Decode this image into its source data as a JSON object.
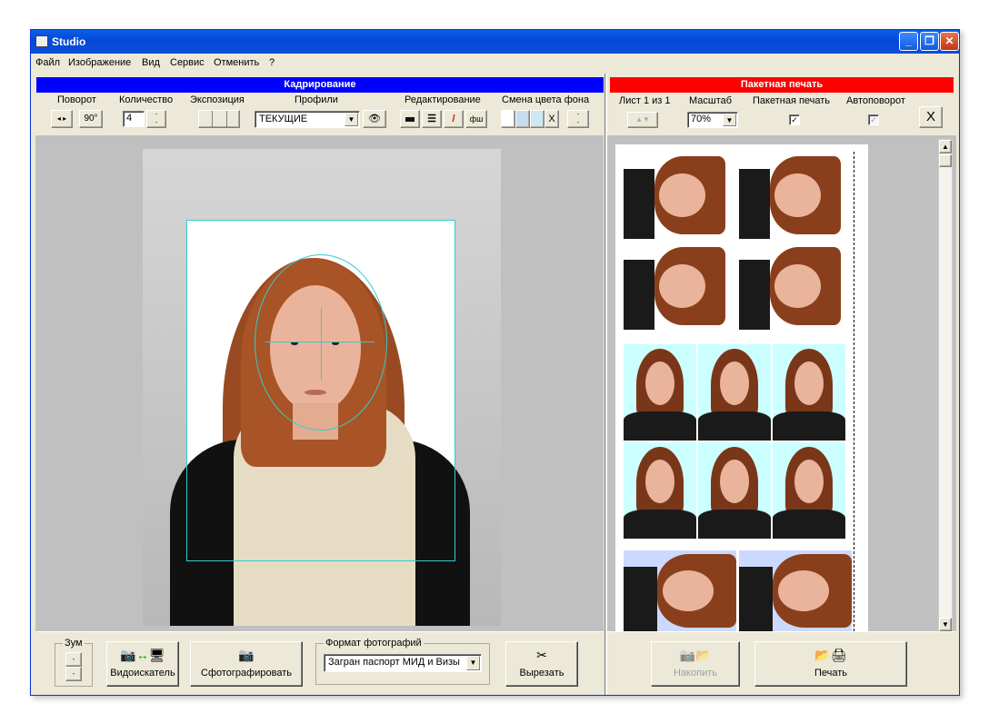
{
  "window": {
    "title": "Studio",
    "min": "_",
    "max": "❐",
    "close": "✕"
  },
  "menu": [
    "Файл",
    "Изображение",
    "Вид",
    "Сервис",
    "Отменить",
    "?"
  ],
  "crop": {
    "header": "Кадрирование",
    "rotate_label": "Поворот",
    "rotate_90": "90°",
    "count_label": "Количество",
    "count_value": "4",
    "exposure_label": "Экспозиция",
    "profiles_label": "Профили",
    "profile_value": "ТЕКУЩИЕ",
    "edit_label": "Редактирование",
    "fsh": "фш",
    "bgcolor_label": "Смена цвета фона",
    "bg_x": "X",
    "colors": {
      "header": "#0000ff",
      "guide": "#33cccc"
    }
  },
  "batch": {
    "header": "Пакетная печать",
    "sheet_label": "Лист 1 из 1",
    "scale_label": "Масштаб",
    "scale_value": "70%",
    "batch_label": "Пакетная печать",
    "autorotate_label": "Автоповорот",
    "close_icon": "X",
    "colors": {
      "header": "#ff0000",
      "cyan_bg": "#ccffff",
      "blue_bg": "#ccd9ff"
    }
  },
  "bottom": {
    "zoom_label": "Зум",
    "viewfinder": "Видоискатель",
    "shoot": "Сфотографировать",
    "format_label": "Формат фотографий",
    "format_value": "Загран паспорт МИД и Визы",
    "cut": "Вырезать",
    "accumulate": "Накопить",
    "print": "Печать"
  }
}
